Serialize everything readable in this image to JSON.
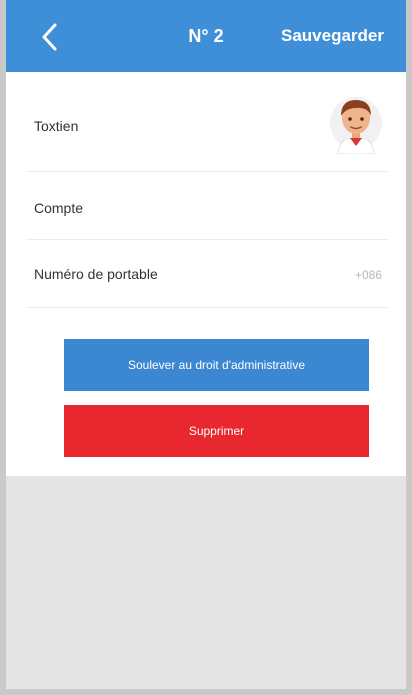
{
  "header": {
    "title": "N° 2",
    "save_label": "Sauvegarder"
  },
  "form": {
    "user_label": "Toxtien",
    "account_label": "Compte",
    "phone_label": "Numéro de portable",
    "phone_value": "+086"
  },
  "buttons": {
    "primary_label": "Soulever au droit d'administrative",
    "delete_label": "Supprimer"
  },
  "colors": {
    "header_bg": "#3f8fd8",
    "primary_button": "#3c87d2",
    "delete_button": "#e8282e"
  }
}
